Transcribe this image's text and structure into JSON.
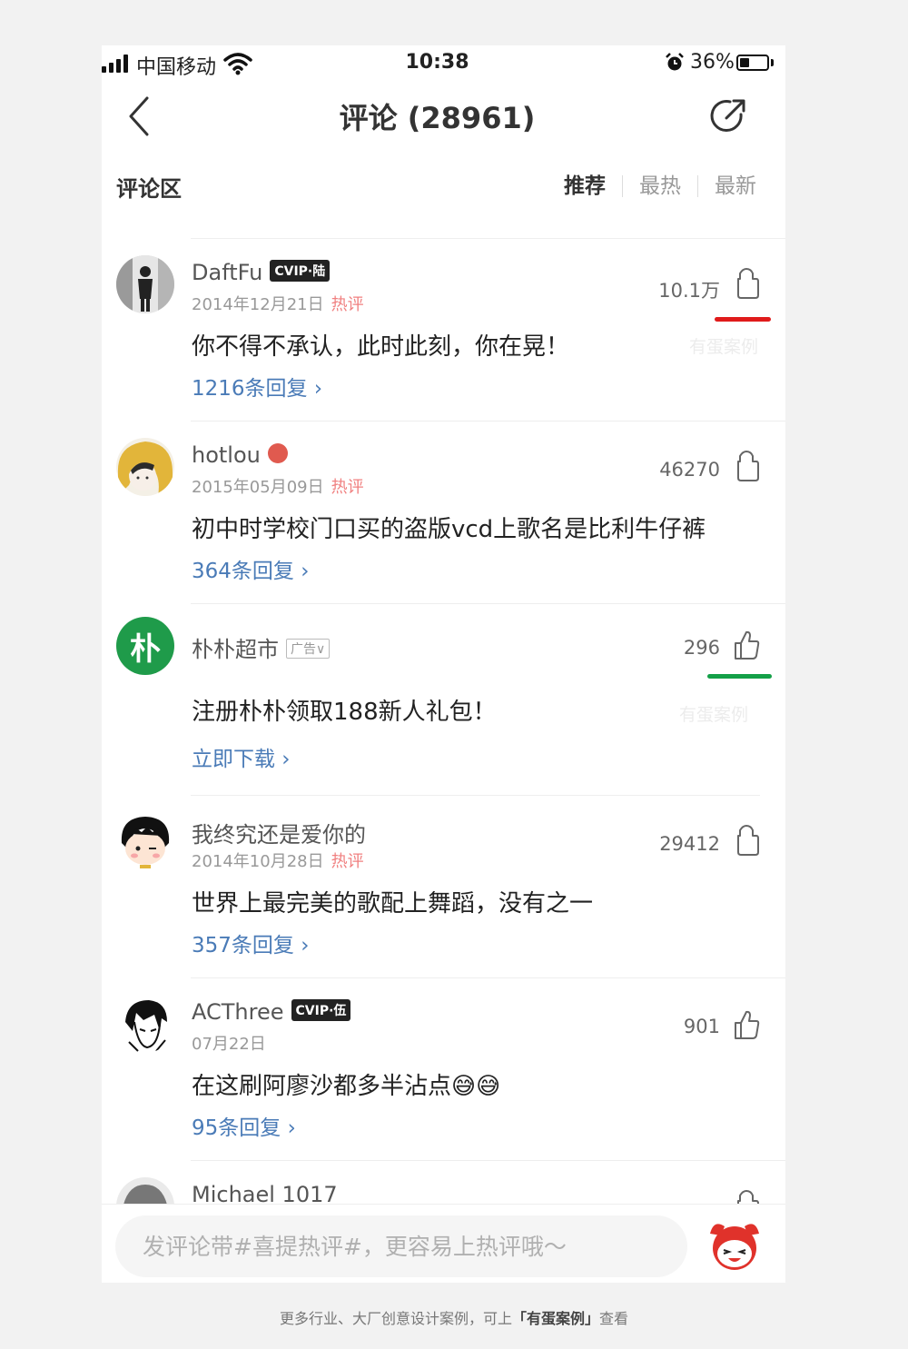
{
  "status_bar": {
    "carrier": "中国移动",
    "time": "10:38",
    "battery_percent": "36%",
    "battery_level": 0.36
  },
  "nav": {
    "title": "评论 (28961)",
    "back_icon": "chevron-left-icon",
    "share_icon": "share-icon"
  },
  "section": {
    "title": "评论区",
    "tabs": [
      {
        "label": "推荐",
        "active": true
      },
      {
        "label": "最热",
        "active": false
      },
      {
        "label": "最新",
        "active": false
      }
    ]
  },
  "comments": [
    {
      "username": "DaftFu",
      "badge": "CVIP·陆",
      "date": "2014年12月21日",
      "hot": "热评",
      "likes": "10.1万",
      "content": "你不得不承认，此时此刻，你在晃！",
      "replies": "1216条回复 ›"
    },
    {
      "username": "hotlou",
      "date": "2015年05月09日",
      "hot": "热评",
      "likes": "46270",
      "content": "初中时学校门口买的盗版vcd上歌名是比利牛仔裤",
      "replies": "364条回复 ›"
    },
    {
      "username": "朴朴超市",
      "avatar_text": "朴",
      "ad_tag": "广告∨",
      "likes": "296",
      "content": "注册朴朴领取188新人礼包！",
      "replies": "立即下载 ›"
    },
    {
      "username": "我终究还是爱你的",
      "date": "2014年10月28日",
      "hot": "热评",
      "likes": "29412",
      "content": "世界上最完美的歌配上舞蹈，没有之一",
      "replies": "357条回复 ›"
    },
    {
      "username": "ACThree",
      "badge": "CVIP·伍",
      "date": "07月22日",
      "likes": "901",
      "content": "在这刷阿廖沙都多半沾点😅😅",
      "replies": "95条回复 ›"
    },
    {
      "username": "Michael 1017"
    }
  ],
  "watermarks": [
    "有蛋案例",
    "有蛋案例"
  ],
  "input": {
    "placeholder": "发评论带#喜提热评#，更容易上热评哦～"
  },
  "footer": {
    "prefix": "更多行业、大厂创意设计案例，可上",
    "brand": "「有蛋案例」",
    "suffix": "查看"
  },
  "colors": {
    "link": "#4a7bb7",
    "hot": "#f08080",
    "highlight_red": "#e01b1b",
    "highlight_green": "#14a048",
    "ad_avatar": "#1f9b4a"
  }
}
